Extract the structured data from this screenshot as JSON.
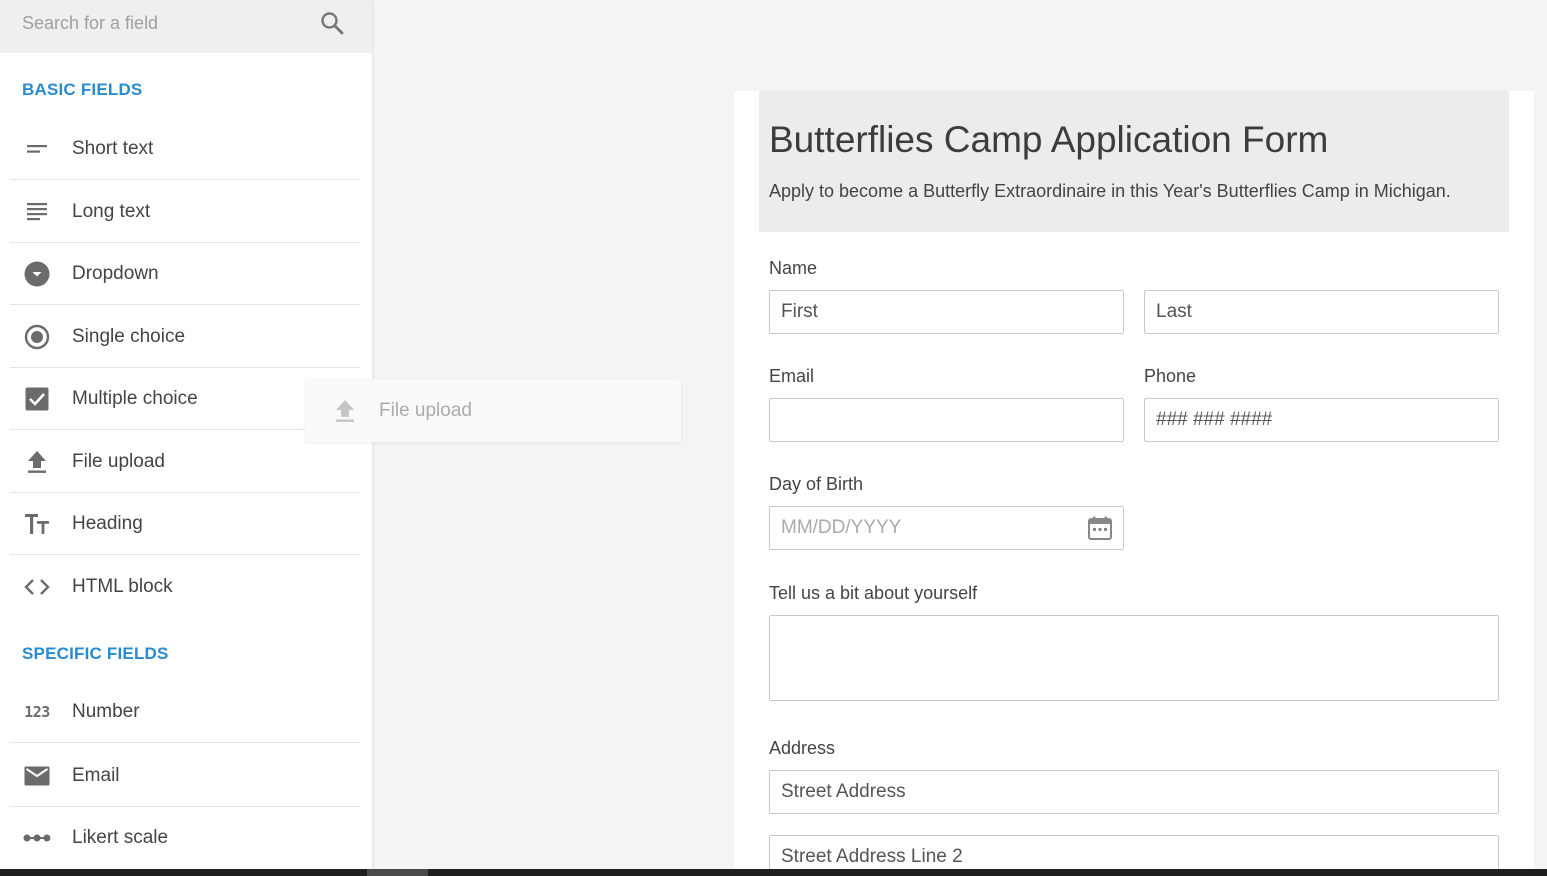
{
  "sidebar": {
    "search_placeholder": "Search for a field",
    "search_icon": "search-icon",
    "sections": {
      "basic": {
        "title": "BASIC FIELDS",
        "items": [
          {
            "label": "Short text",
            "icon": "short-text-icon"
          },
          {
            "label": "Long text",
            "icon": "long-text-icon"
          },
          {
            "label": "Dropdown",
            "icon": "dropdown-icon"
          },
          {
            "label": "Single choice",
            "icon": "radio-icon"
          },
          {
            "label": "Multiple choice",
            "icon": "checkbox-icon"
          },
          {
            "label": "File upload",
            "icon": "upload-icon"
          },
          {
            "label": "Heading",
            "icon": "heading-icon"
          },
          {
            "label": "HTML block",
            "icon": "code-icon"
          }
        ]
      },
      "specific": {
        "title": "SPECIFIC FIELDS",
        "items": [
          {
            "label": "Number",
            "icon": "number-icon",
            "glyph": "123"
          },
          {
            "label": "Email",
            "icon": "envelope-icon"
          },
          {
            "label": "Likert scale",
            "icon": "likert-icon"
          }
        ]
      }
    }
  },
  "drag_ghost": {
    "label": "File upload",
    "icon": "upload-icon"
  },
  "form": {
    "title": "Butterflies Camp Application Form",
    "description": "Apply to become a Butterfly Extraordinaire in this Year's Butterflies Camp in Michigan.",
    "fields": {
      "name": {
        "label": "Name",
        "first_placeholder": "First",
        "last_placeholder": "Last"
      },
      "email": {
        "label": "Email",
        "placeholder": ""
      },
      "phone": {
        "label": "Phone",
        "placeholder": "### ### ####"
      },
      "dob": {
        "label": "Day of Birth",
        "placeholder": "MM/DD/YYYY",
        "icon": "calendar-icon"
      },
      "about": {
        "label": "Tell us a bit about yourself",
        "placeholder": ""
      },
      "address": {
        "label": "Address",
        "street_placeholder": "Street Address",
        "street2_placeholder": "Street Address Line 2"
      }
    }
  },
  "colors": {
    "accent": "#2a8bd0",
    "icon": "#6b6b6b",
    "header_bg": "#ececec"
  }
}
